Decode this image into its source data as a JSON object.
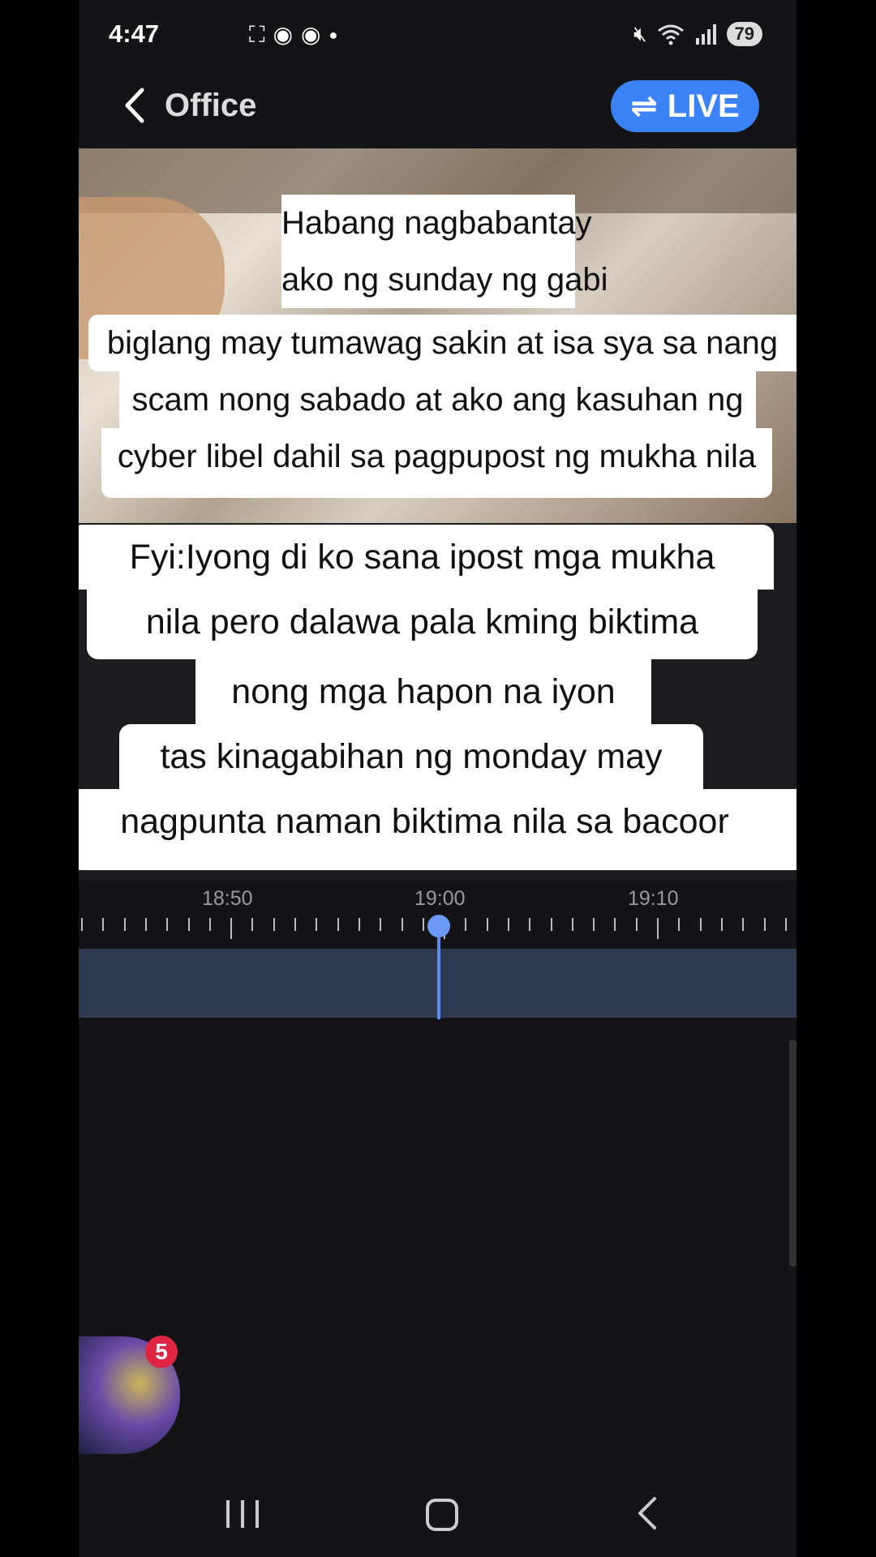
{
  "status_bar": {
    "time": "4:47",
    "left_icons": [
      "screenshot-icon",
      "messenger-icon",
      "messenger-icon",
      "dot-icon"
    ],
    "right_icons": [
      "mute-icon",
      "wifi-icon",
      "signal-icon"
    ],
    "battery": "79"
  },
  "header": {
    "back_icon": "chevron-left-icon",
    "title": "Office",
    "live_label": "LIVE",
    "live_icon": "swap-arrows-icon",
    "live_color": "#3b82f6"
  },
  "captions": [
    "Habang nagbabantay",
    "ako ng sunday ng gabi",
    "biglang may tumawag sakin at isa sya sa nang",
    "scam nong sabado at ako ang kasuhan ng",
    "cyber libel dahil sa pagpupost ng mukha nila",
    "Fyi:Iyong di ko sana ipost mga mukha",
    "nila pero dalawa pala kming biktima",
    "nong mga hapon na iyon",
    "tas kinagabihan ng monday may",
    "nagpunta naman biktima nila sa bacoor"
  ],
  "timeline": {
    "labels": [
      "18:50",
      "19:00",
      "19:10"
    ],
    "cursor_color": "#5b8cf0"
  },
  "chat_head": {
    "badge_count": "5"
  },
  "nav_bar": {
    "icons": [
      "recent-apps-icon",
      "home-icon",
      "back-icon"
    ]
  }
}
